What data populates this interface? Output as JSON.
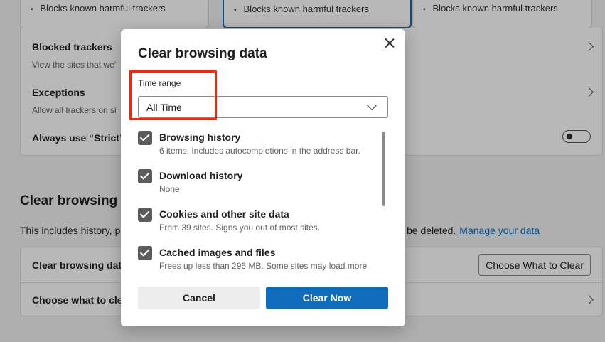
{
  "background": {
    "tracker_cards": [
      {
        "bullet": "Blocks known harmful trackers"
      },
      {
        "bullet": "Blocks known harmful trackers"
      },
      {
        "bullet": "Blocks known harmful trackers"
      }
    ],
    "rows": {
      "blocked_trackers": {
        "title": "Blocked trackers",
        "subtitle": "View the sites that we'"
      },
      "exceptions": {
        "title": "Exceptions",
        "subtitle": "Allow all trackers on si"
      },
      "always_strict": {
        "title": "Always use “Strict”"
      }
    },
    "clear_section": {
      "title": "Clear browsing",
      "description": "This includes history, p",
      "deleted_text": "be deleted.",
      "manage_link": "Manage your data",
      "row1_label": "Clear browsing dat",
      "choose_button": "Choose What to Clear",
      "row2_label": "Choose what to cle"
    }
  },
  "dialog": {
    "title": "Clear browsing data",
    "time_range_label": "Time range",
    "time_range_value": "All Time",
    "items": [
      {
        "title": "Browsing history",
        "subtitle": "6 items. Includes autocompletions in the address bar.",
        "checked": true
      },
      {
        "title": "Download history",
        "subtitle": "None",
        "checked": true
      },
      {
        "title": "Cookies and other site data",
        "subtitle": "From 39 sites. Signs you out of most sites.",
        "checked": true
      },
      {
        "title": "Cached images and files",
        "subtitle": "Frees up less than 296 MB. Some sites may load more",
        "checked": true
      }
    ],
    "cancel_label": "Cancel",
    "clear_label": "Clear Now"
  },
  "colors": {
    "accent": "#0f6cbd",
    "highlight": "#ff2200",
    "checkbox": "#5c5c5c"
  }
}
